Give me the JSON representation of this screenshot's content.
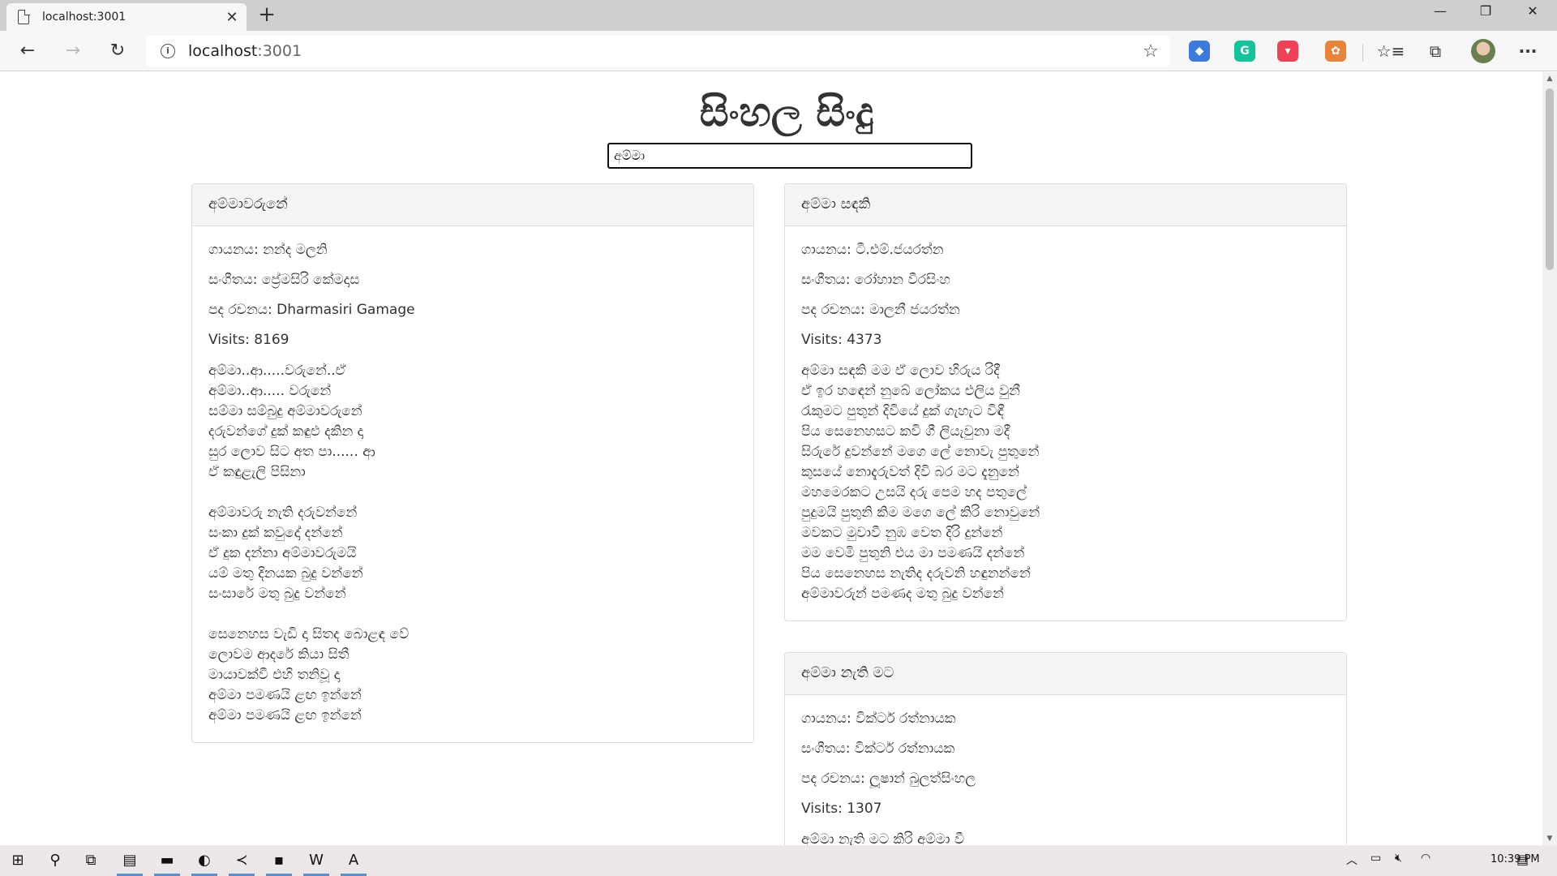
{
  "browser": {
    "tab_title": "localhost:3001",
    "url_host": "localhost",
    "url_port": ":3001",
    "tab_close_glyph": "✕",
    "new_tab_glyph": "+",
    "back_glyph": "←",
    "forward_glyph": "→",
    "reload_glyph": "↻",
    "star_glyph": "☆",
    "menu_glyph": "···",
    "info_glyph": "i",
    "minimize_glyph": "—",
    "restore_glyph": "❐",
    "close_glyph": "✕",
    "extensions": [
      {
        "name": "blue-ext-icon",
        "color": "#3b7bdd",
        "glyph": "◆"
      },
      {
        "name": "grammarly-icon",
        "color": "#15c39a",
        "glyph": "G"
      },
      {
        "name": "pocket-icon",
        "color": "#ef4056",
        "glyph": "▾"
      },
      {
        "name": "multi-ext-icon",
        "color": "#e8833a",
        "glyph": "✿"
      }
    ]
  },
  "page": {
    "title": "සිංහල සිංදු",
    "search_value": "අම්මා"
  },
  "songs": [
    {
      "title": "අම්මාවරුනේ",
      "singer": "ගායනය: නන්ද මලනි",
      "music": "සංගීතය: ප්‍රේමසිරි කේමදාස",
      "lyricist": "පද රචනය: Dharmasiri Gamage",
      "visits": "Visits: 8169",
      "stanzas": [
        [
          "අම්මා..ආ.....වරුනේ..ඒ",
          "අම්මා..ආ..... වරුනේ",
          "සම්මා සම්බුදු අම්මාවරුනේ",
          "දරුවන්ගේ දුක් කඳුළු දකින දා",
          "සුර ලොව සිට අත පා...... ආ",
          "ඒ කඳුළැලි පිසිනා"
        ],
        [
          "අම්මාවරු නැති දරුවන්නේ",
          "සංකා දුක් කවුදෝ දන්නේ",
          "ඒ දුක දන්නා අම්මාවරුමයි",
          "යම් මතු දිනයක බුදු වන්නේ",
          "සංසාරේ මතු බුදු වන්නේ"
        ],
        [
          "සෙනෙහස වැඩි දා සිතද බොළඳ වේ",
          "ලොවම ආදරේ කියා සිතී",
          "මායාවක්වී එහි තනිවූ දා",
          "අම්මා පමණයි ළඟ ඉන්නේ",
          "අම්මා පමණයි ළඟ ඉන්නේ"
        ]
      ]
    },
    {
      "title": "අම්මා සඳකි",
      "singer": "ගායනය: ටී.එම්.ජයරත්න",
      "music": "සංගීතය: රෝහාන වීරසිංහ",
      "lyricist": "පද රචනය: මාලනී ජයරත්න",
      "visits": "Visits: 4373",
      "stanzas": [
        [
          "අම්මා සඳකි මම ඒ ලොව හිරුය රිදී",
          "ඒ ඉර හඳෙන් නුබේ ලෝකය එලිය වුනී",
          "රැකුමට පුතුන් දිවියේ දුක් ගැහැට විඳී",
          "පිය සෙනෙහසට කවි ගී ලියැවුනා මදී",
          "සිරුරේ දුවන්නේ මගෙ ලේ නොවැ පුතුනේ",
          "කුසයේ නොදැරුවත් දිවි බර මට දැනුනේ",
          "මහමෙරකට උසයි දරු පෙම හද පතුලේ",
          "පුදුමයි පුතුනි කිම මගෙ ලේ කිරි නොවුනේ",
          "මවකට මුවාවී නුඹ වෙත දිරි දුන්නේ",
          "මම වෙමි පුතුනි එය මා පමණයි දන්නේ",
          "පිය සෙනෙහස නැතිද දරුවනි හඳුනන්නේ",
          "අම්මාවරුන් පමණද මතු බුදු වන්නේ"
        ]
      ]
    },
    {
      "title": "අම්මා නැති මට",
      "singer": "ගායනය: වික්ටර් රත්නායක",
      "music": "සංගීතය: වික්ටර් රත්නායක",
      "lyricist": "පද රචනය: ලූෂාන් බුලත්සිංහල",
      "visits": "Visits: 1307",
      "stanzas": [
        [
          "අම්මා නැති මට කිරි අම්මා වී"
        ]
      ]
    }
  ],
  "taskbar": {
    "clock": "10:39 PM",
    "icons": [
      {
        "name": "windows-start-icon",
        "glyph": "⊞"
      },
      {
        "name": "search-icon",
        "glyph": "⚲"
      },
      {
        "name": "task-view-icon",
        "glyph": "⧉"
      },
      {
        "name": "sticky-app-icon",
        "glyph": "▤"
      },
      {
        "name": "file-explorer-icon",
        "glyph": "▬"
      },
      {
        "name": "edge-browser-icon",
        "glyph": "◐"
      },
      {
        "name": "vscode-icon",
        "glyph": "≺"
      },
      {
        "name": "terminal-icon",
        "glyph": "▪"
      },
      {
        "name": "word-icon",
        "glyph": "W"
      },
      {
        "name": "acrobat-icon",
        "glyph": "A"
      }
    ]
  }
}
